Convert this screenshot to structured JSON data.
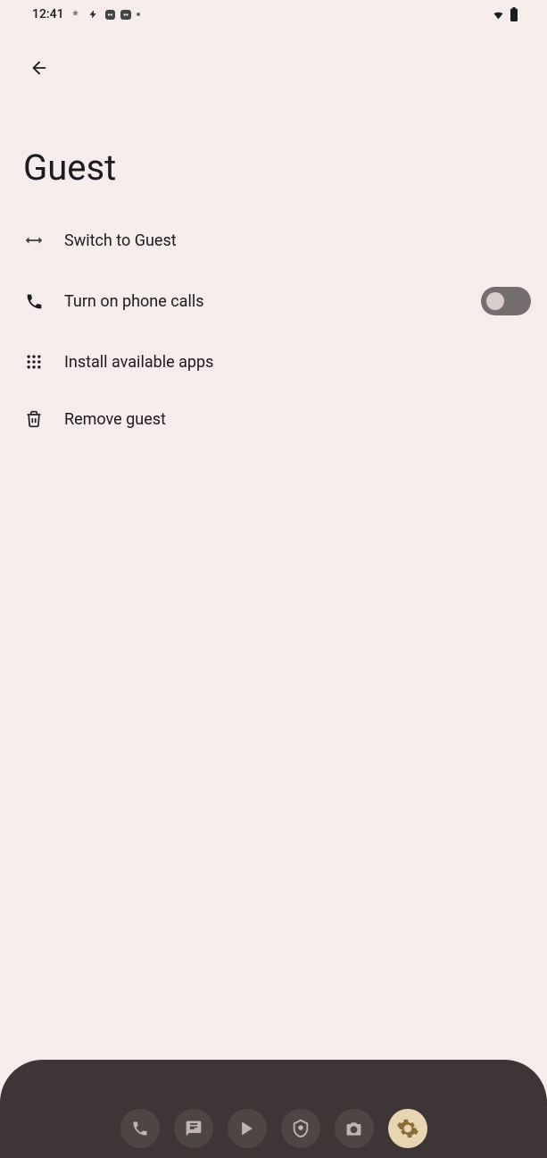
{
  "status_bar": {
    "time": "12:41"
  },
  "page": {
    "title": "Guest"
  },
  "items": {
    "switch": "Switch to Guest",
    "phone": "Turn on phone calls",
    "install": "Install available apps",
    "remove": "Remove guest"
  },
  "toggle": {
    "phone_calls_on": false
  }
}
